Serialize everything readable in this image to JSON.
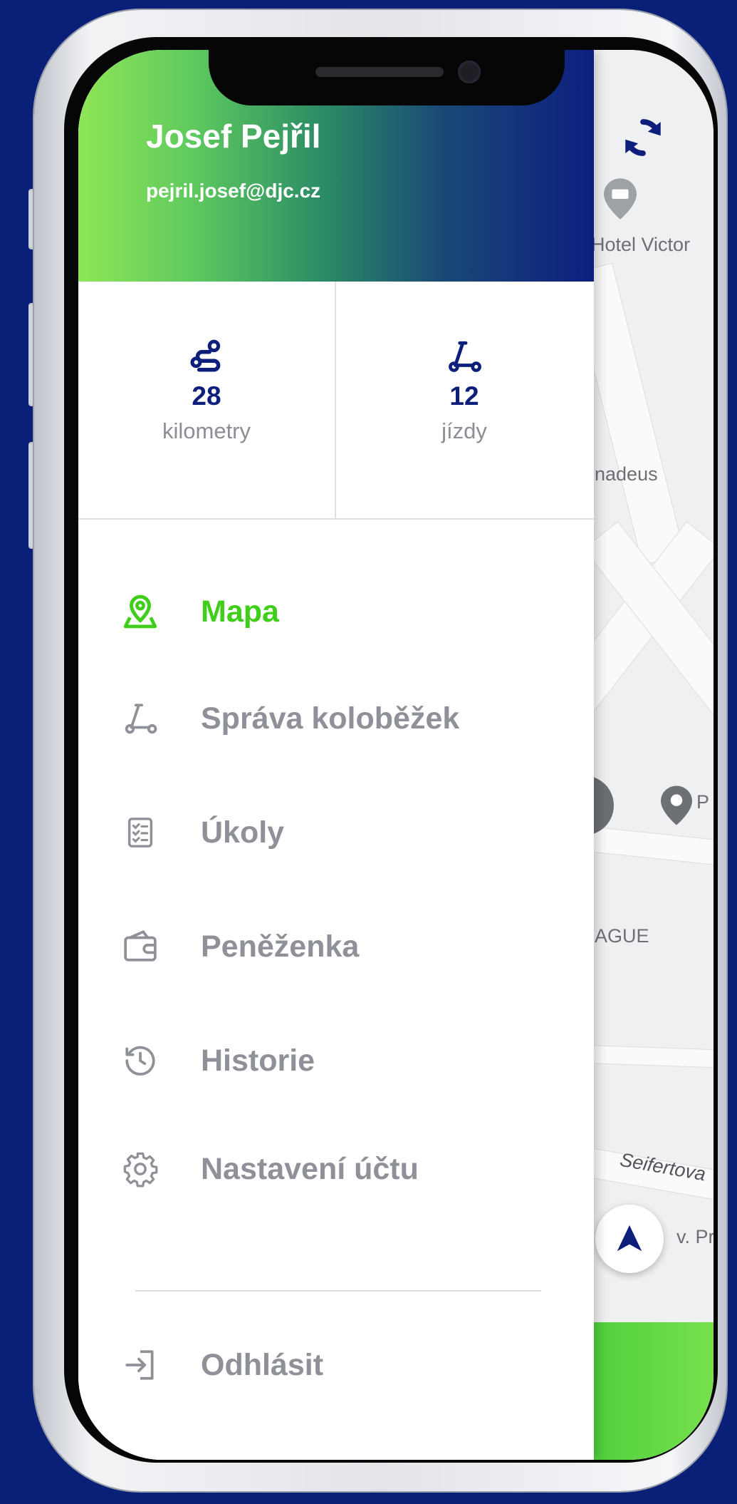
{
  "colors": {
    "background": "#0a1f78",
    "accent_green": "#3fcf1a",
    "navy": "#0d1f7a",
    "muted_text": "#8e9197"
  },
  "drawer": {
    "user_name": "Josef Pejřil",
    "user_email": "pejril.josef@djc.cz",
    "stats": [
      {
        "icon": "route-icon",
        "value": "28",
        "label": "kilometry"
      },
      {
        "icon": "scooter-icon",
        "value": "12",
        "label": "jízdy"
      }
    ],
    "menu": [
      {
        "icon": "map-pin-icon",
        "label": "Mapa",
        "active": true
      },
      {
        "icon": "scooter-icon",
        "label": "Správa koloběžek",
        "active": false
      },
      {
        "icon": "checklist-icon",
        "label": "Úkoly",
        "active": false
      },
      {
        "icon": "wallet-icon",
        "label": "Peněženka",
        "active": false
      },
      {
        "icon": "history-icon",
        "label": "Historie",
        "active": false
      },
      {
        "icon": "gear-icon",
        "label": "Nastavení účtu",
        "active": false
      }
    ],
    "logout_label": "Odhlásit"
  },
  "map": {
    "labels": {
      "hotel": "Hotel Victor",
      "amadeus": "nadeus",
      "prague": "AGUE",
      "street": "Seifertova",
      "street2": "v. Pr",
      "poi_p": "P"
    }
  }
}
